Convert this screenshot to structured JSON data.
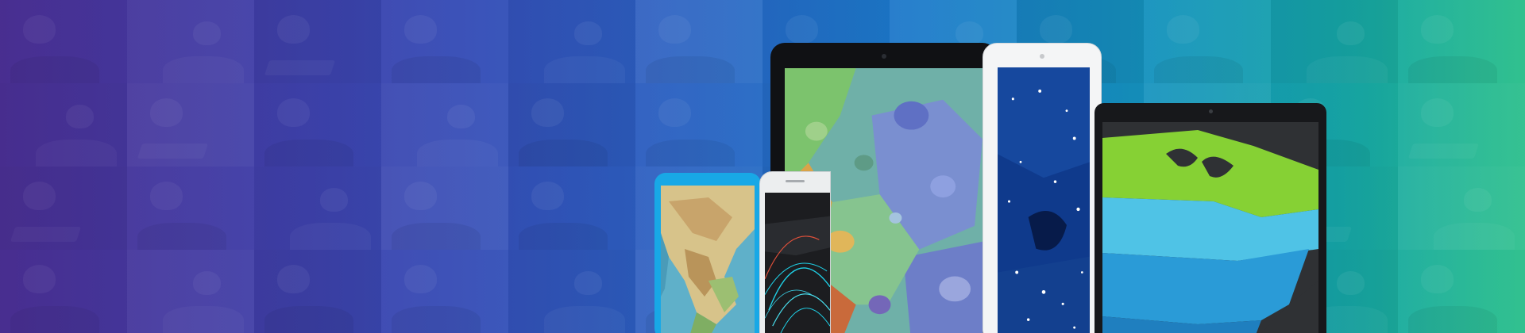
{
  "banner": {
    "photo_tiles": 48,
    "devices": [
      "tablet",
      "tablet",
      "laptop",
      "phone",
      "phone"
    ],
    "colors": {
      "gradient_left": "#4a2f93",
      "gradient_mid": "#1a79c9",
      "gradient_right": "#2cbf8c",
      "blue_phone": "#18a8e6"
    }
  }
}
